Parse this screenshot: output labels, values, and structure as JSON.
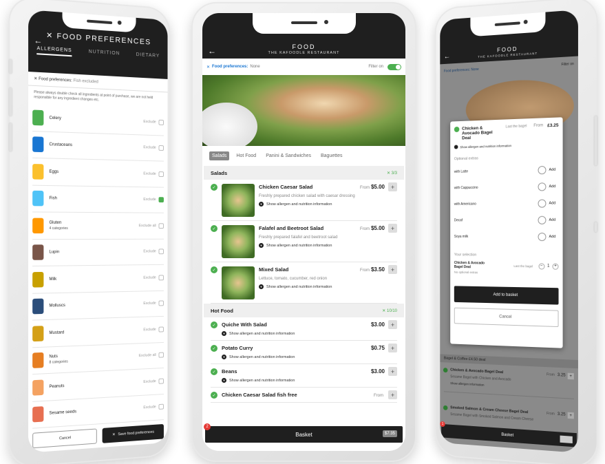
{
  "phone1": {
    "title": "FOOD PREFERENCES",
    "tabs": [
      "ALLERGENS",
      "NUTRITION",
      "DIETARY"
    ],
    "pref_label": "Food preferences:",
    "pref_value": "Fish excluded",
    "note": "Please always double check all ingredients at point of purchase, we are not held responsible for any ingredient changes etc.",
    "allergens": [
      {
        "name": "Celery",
        "action": "Exclude",
        "checked": false,
        "color": "#4caf50",
        "sub": ""
      },
      {
        "name": "Crustaceans",
        "action": "Exclude",
        "checked": false,
        "color": "#1976d2",
        "sub": ""
      },
      {
        "name": "Eggs",
        "action": "Exclude",
        "checked": false,
        "color": "#fbc02d",
        "sub": ""
      },
      {
        "name": "Fish",
        "action": "Exclude",
        "checked": true,
        "color": "#4fc3f7",
        "sub": ""
      },
      {
        "name": "Gluten",
        "action": "Exclude all",
        "checked": false,
        "color": "#ff9800",
        "sub": "4 categories"
      },
      {
        "name": "Lupin",
        "action": "Exclude",
        "checked": false,
        "color": "#795548",
        "sub": ""
      },
      {
        "name": "Milk",
        "action": "Exclude",
        "checked": false,
        "color": "#c8a000",
        "sub": ""
      },
      {
        "name": "Molluscs",
        "action": "Exclude",
        "checked": false,
        "color": "#2b4d7a",
        "sub": ""
      },
      {
        "name": "Mustard",
        "action": "Exclude",
        "checked": false,
        "color": "#d4a017",
        "sub": ""
      },
      {
        "name": "Nuts",
        "action": "Exclude all",
        "checked": false,
        "color": "#e67e22",
        "sub": "8 categories"
      },
      {
        "name": "Peanuts",
        "action": "Exclude",
        "checked": false,
        "color": "#f4a261",
        "sub": ""
      },
      {
        "name": "Sesame seeds",
        "action": "Exclude",
        "checked": false,
        "color": "#e76f51",
        "sub": ""
      }
    ],
    "cancel_label": "Cancel",
    "save_label": "Save food preferences"
  },
  "phone2": {
    "title": "FOOD",
    "subtitle": "THE KAFOODLE RESTAURANT",
    "pref_label": "Food preferences:",
    "pref_value": "None",
    "filter_label": "Filter on",
    "tabs": [
      "Salads",
      "Hot Food",
      "Panini & Sandwiches",
      "Baguettes"
    ],
    "sections": [
      {
        "name": "Salads",
        "count": "3/3",
        "items": [
          {
            "name": "Chicken Caesar Salad",
            "from": "From",
            "price": "$5.00",
            "desc": "Freshly prepared chicken salad with caesar dressing",
            "allergen": "Show allergen and nutrition information"
          },
          {
            "name": "Falafel and Beetroot Salad",
            "from": "From",
            "price": "$5.00",
            "desc": "Freshly prepared falafel and beetroot salad",
            "allergen": "Show allergen and nutrition information"
          },
          {
            "name": "Mixed Salad",
            "from": "From",
            "price": "$3.50",
            "desc": "Lettuce, tomato, cucumber, red onion",
            "allergen": "Show allergen and nutrition information"
          }
        ]
      },
      {
        "name": "Hot Food",
        "count": "10/10",
        "items": [
          {
            "name": "Quiche With Salad",
            "from": "",
            "price": "$3.00",
            "allergen": "Show allergen and nutrition information"
          },
          {
            "name": "Potato Curry",
            "from": "",
            "price": "$0.75",
            "allergen": "Show allergen and nutrition information"
          },
          {
            "name": "Beans",
            "from": "",
            "price": "$3.00",
            "allergen": "Show allergen and nutrition information"
          },
          {
            "name": "Chicken Caesar Salad fish free",
            "from": "From",
            "price": "",
            "allergen": ""
          }
        ]
      }
    ],
    "basket_label": "Basket",
    "basket_badge": "2",
    "basket_total": "$7.35"
  },
  "phone3": {
    "title": "FOOD",
    "subtitle": "THE KAFOODLE RESTAURANT",
    "pref_text": "Food preferences: None",
    "filter_label": "Filter on",
    "modal": {
      "name": "Chicken & Avocado Bagel Deal",
      "last_label": "Last the bagel",
      "from": "From",
      "price": "£3.25",
      "allergen": "Show allergen and nutrition information",
      "extras_heading": "Optional extras",
      "extras": [
        {
          "name": "with Latte",
          "action": "Add"
        },
        {
          "name": "with Cappuccino",
          "action": "Add"
        },
        {
          "name": "with Americano",
          "action": "Add"
        },
        {
          "name": "Decaf",
          "action": "Add"
        },
        {
          "name": "Soya milk",
          "action": "Add"
        }
      ],
      "selection_heading": "Your selection",
      "selection_name": "Chicken & Avocado Bagel Deal",
      "selection_last": "Last the bagel",
      "selection_qty": "1",
      "no_extras": "No optional extras",
      "add_label": "Add to basket",
      "cancel_label": "Cancel"
    },
    "background_section": "Bagel & Coffee £4.50 deal",
    "background_items": [
      {
        "name": "Chicken & Avocado Bagel Deal",
        "from": "From",
        "price": "3.25",
        "desc": "Sesame Bagel with Chicken and Avocado",
        "allergen": "Show allergen information"
      },
      {
        "name": "Smoked Salmon & Cream Cheese Bagel Deal",
        "from": "From",
        "price": "3.25",
        "desc": "Sesame Bagel with Smoked Salmon and Cream Cheese",
        "allergen": ""
      }
    ],
    "basket_label": "Basket",
    "basket_badge": "1"
  }
}
